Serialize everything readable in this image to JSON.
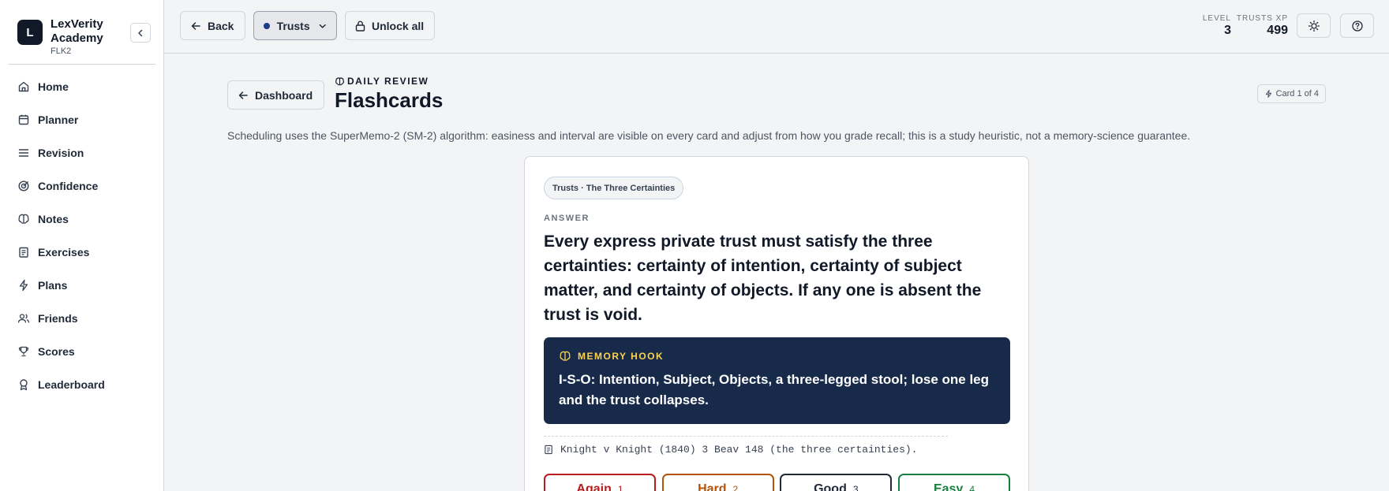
{
  "app": {
    "logo_letter": "L",
    "name": "LexVerity Academy",
    "sub": "FLK2"
  },
  "sidebar": {
    "items": [
      {
        "label": "Home",
        "icon": "home-icon"
      },
      {
        "label": "Planner",
        "icon": "calendar-icon"
      },
      {
        "label": "Revision",
        "icon": "list-icon"
      },
      {
        "label": "Confidence",
        "icon": "target-icon"
      },
      {
        "label": "Notes",
        "icon": "brain-icon"
      },
      {
        "label": "Exercises",
        "icon": "clipboard-icon"
      },
      {
        "label": "Plans",
        "icon": "bolt-icon"
      },
      {
        "label": "Friends",
        "icon": "users-icon"
      },
      {
        "label": "Scores",
        "icon": "trophy-icon"
      },
      {
        "label": "Leaderboard",
        "icon": "medal-icon"
      }
    ]
  },
  "topbar": {
    "back_label": "Back",
    "subject_label": "Trusts",
    "unlock_label": "Unlock all",
    "level_label": "LEVEL",
    "level_value": "3",
    "xp_label": "TRUSTS XP",
    "xp_value": "499"
  },
  "main": {
    "dashboard_label": "Dashboard",
    "eyebrow": "DAILY REVIEW",
    "title": "Flashcards",
    "card_counter": "Card 1 of 4",
    "description": "Scheduling uses the SuperMemo-2 (SM-2) algorithm: easiness and interval are visible on every card and adjust from how you grade recall; this is a study heuristic, not a memory-science guarantee."
  },
  "card": {
    "topic": "Trusts · The Three Certainties",
    "answer_label": "ANSWER",
    "answer_text": "Every express private trust must satisfy the three certainties: certainty of intention, certainty of subject matter, and certainty of objects. If any one is absent the trust is void.",
    "hook_label": "MEMORY HOOK",
    "hook_text": "I-S-O: Intention, Subject, Objects, a three-legged stool; lose one leg and the trust collapses.",
    "citation": "Knight v Knight (1840) 3 Beav 148 (the three certainties).",
    "grades": [
      {
        "label": "Again",
        "key": "1"
      },
      {
        "label": "Hard",
        "key": "2"
      },
      {
        "label": "Good",
        "key": "3"
      },
      {
        "label": "Easy",
        "key": "4"
      }
    ]
  },
  "colors": {
    "sidebar_bg": "#ffffff",
    "page_bg": "#f3f4f6",
    "hook_bg": "#172a4a",
    "hook_accent": "#fcd34d",
    "again": "#b91c1c",
    "hard": "#b45309",
    "good": "#1f2937",
    "easy": "#15803d"
  }
}
